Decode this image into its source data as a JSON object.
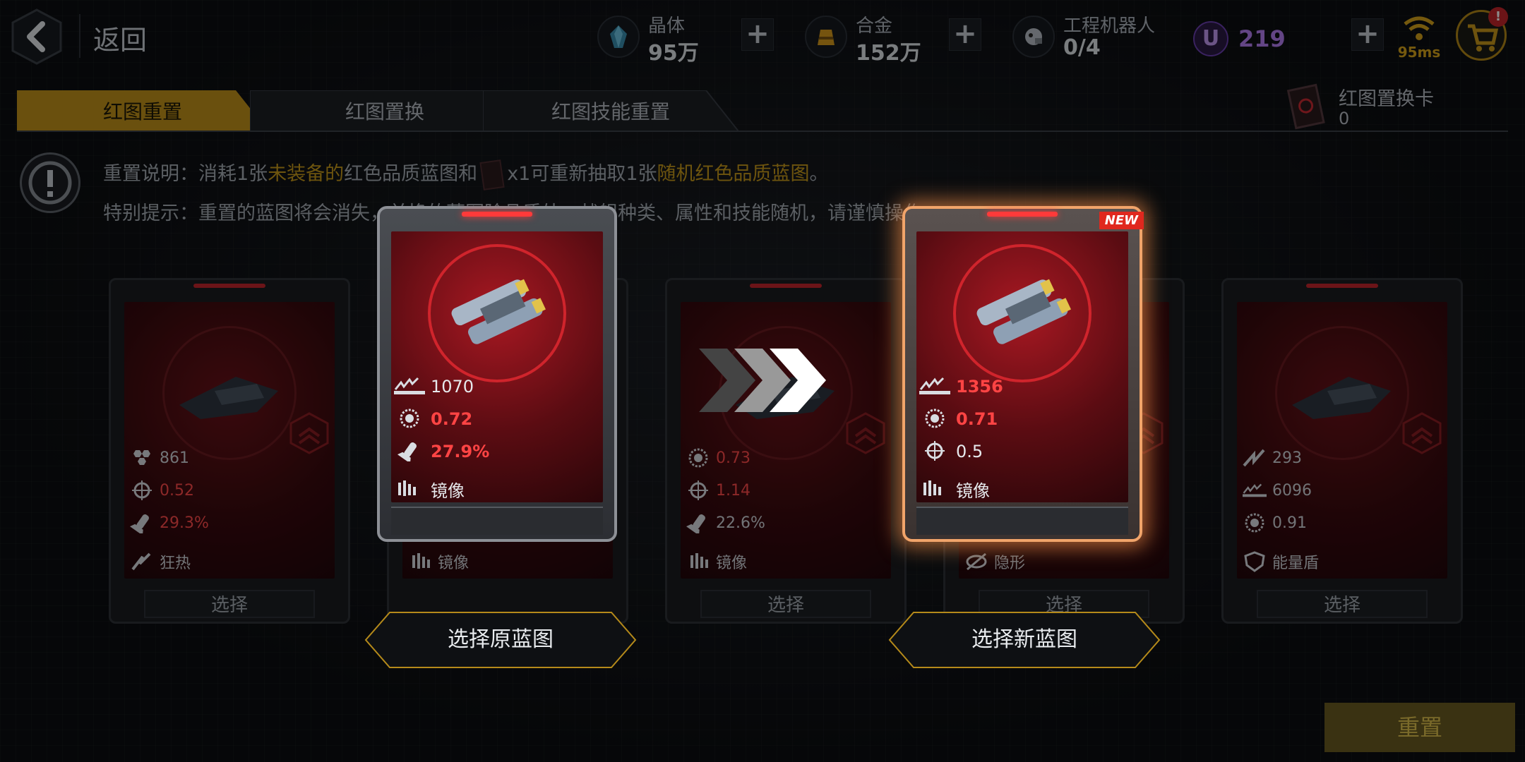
{
  "header": {
    "back_label": "返回",
    "resources": [
      {
        "name": "晶体",
        "value": "95万",
        "icon": "crystal-icon"
      },
      {
        "name": "合金",
        "value": "152万",
        "icon": "alloy-icon"
      },
      {
        "name": "工程机器人",
        "value": "0/4",
        "icon": "robot-icon"
      }
    ],
    "u_coin": "219",
    "ping": "95ms",
    "cart_badge": "!"
  },
  "tabs": [
    {
      "label": "红图重置",
      "active": true
    },
    {
      "label": "红图置换",
      "active": false
    },
    {
      "label": "红图技能重置",
      "active": false
    }
  ],
  "swap_card": {
    "label": "红图置换卡",
    "count": "0"
  },
  "info": {
    "line1_prefix": "重置说明：消耗1张",
    "line1_hl1": "未装备的",
    "line1_mid": "红色品质蓝图和",
    "line1_x": "x1可重新抽取1张",
    "line1_hl2": "随机红色品质蓝图",
    "line1_end": "。",
    "line2": "特别提示：重置的蓝图将会消失，并换的蓝图除品质外，战舰种类、属性和技能随机，请谨慎操作"
  },
  "cards": [
    {
      "stats": [
        {
          "icon": "hexagons-icon",
          "value": "861",
          "red": false
        },
        {
          "icon": "crosshair-icon",
          "value": "0.52",
          "red": true
        },
        {
          "icon": "missile-icon",
          "value": "29.3%",
          "red": true
        }
      ],
      "skill": "狂热",
      "select": "选择"
    },
    {
      "stats": [],
      "skill": "镜像",
      "select": ""
    },
    {
      "stats": [
        {
          "icon": "gear-icon",
          "value": "0.73",
          "red": true
        },
        {
          "icon": "crosshair-icon",
          "value": "1.14",
          "red": true
        },
        {
          "icon": "missile-icon",
          "value": "22.6%",
          "red": false
        }
      ],
      "skill": "镜像",
      "select": "选择"
    },
    {
      "stats": [],
      "skill": "隐形",
      "select": "选择"
    },
    {
      "stats": [
        {
          "icon": "wings-icon",
          "value": "293",
          "red": false
        },
        {
          "icon": "speed-icon",
          "value": "6096",
          "red": false
        },
        {
          "icon": "gear-icon",
          "value": "0.91",
          "red": false
        }
      ],
      "skill": "能量盾",
      "select": "选择"
    }
  ],
  "original": {
    "stats": [
      {
        "icon": "speed-icon",
        "value": "1070",
        "red": false
      },
      {
        "icon": "gear-icon",
        "value": "0.72",
        "red": true
      },
      {
        "icon": "missile-icon",
        "value": "27.9%",
        "red": true
      }
    ],
    "skill": "镜像"
  },
  "new_card": {
    "badge": "NEW",
    "stats": [
      {
        "icon": "speed-icon",
        "value": "1356",
        "red": true
      },
      {
        "icon": "gear-icon",
        "value": "0.71",
        "red": true
      },
      {
        "icon": "crosshair-icon",
        "value": "0.5",
        "red": false
      }
    ],
    "skill": "镜像"
  },
  "buttons": {
    "choose_original": "选择原蓝图",
    "choose_new": "选择新蓝图",
    "reset": "重置"
  },
  "colors": {
    "accent_gold": "#c79a1a",
    "stat_red": "#ff4444",
    "new_glow": "#f1a46a"
  }
}
